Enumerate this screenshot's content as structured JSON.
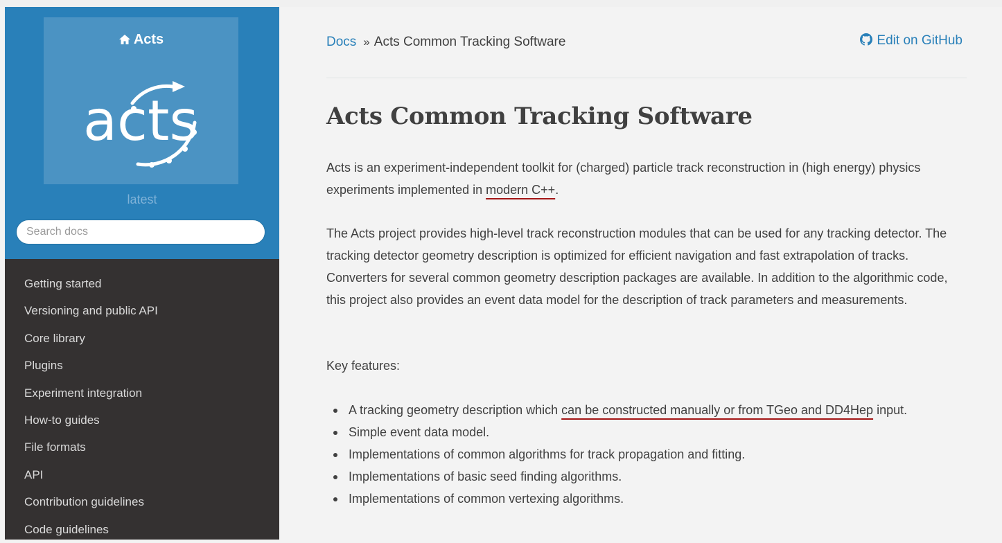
{
  "sidebar": {
    "home_label": "Acts",
    "logo_text": "acts",
    "version": "latest",
    "search_placeholder": "Search docs",
    "nav": [
      "Getting started",
      "Versioning and public API",
      "Core library",
      "Plugins",
      "Experiment integration",
      "How-to guides",
      "File formats",
      "API",
      "Contribution guidelines",
      "Code guidelines"
    ]
  },
  "breadcrumb": {
    "docs_label": "Docs",
    "separator": "»",
    "current": "Acts Common Tracking Software"
  },
  "edit_link": "Edit on GitHub",
  "title": "Acts Common Tracking Software",
  "intro": {
    "before": "Acts is an experiment-independent toolkit for (charged) particle track reconstruction in (high energy) physics experiments implemented in",
    "underlined": "modern C++",
    "after": "."
  },
  "paragraph2": "The Acts project provides high-level track reconstruction modules that can be used for any tracking detector. The tracking detector geometry description is optimized for efficient navigation and fast extrapolation of tracks. Converters for several common geometry description packages are available. In addition to the algorithmic code, this project also provides an event data model for the description of track parameters and measurements.",
  "key_features_label": "Key features:",
  "features": {
    "first_before": "A tracking geometry description which",
    "first_underlined": "can be constructed manually or from TGeo and DD4Hep",
    "first_after": "input.",
    "items": [
      "Simple event data model.",
      "Implementations of common algorithms for track propagation and fitting.",
      "Implementations of basic seed finding algorithms.",
      "Implementations of common vertexing algorithms."
    ]
  },
  "colors": {
    "sidebar_header": "#2980b9",
    "sidebar_body": "#343131",
    "link": "#2980b9",
    "text": "#404040",
    "annotation_underline": "#a31515"
  }
}
